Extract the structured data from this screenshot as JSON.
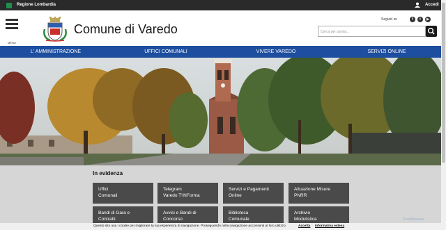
{
  "topbar": {
    "region_label": "Regione Lombardia",
    "login_label": "Accedi"
  },
  "header": {
    "menu_label": "MENU",
    "site_title": "Comune di Varedo",
    "social_label": "Seguici su",
    "search_placeholder": "Cerca per parola..."
  },
  "nav": {
    "items": [
      {
        "label": "L' AMMINISTRAZIONE"
      },
      {
        "label": "UFFICI COMUNALI"
      },
      {
        "label": "VIVERE VAREDO"
      },
      {
        "label": "SERVIZI ONLINE"
      }
    ]
  },
  "evidenza": {
    "title": "In evidenza",
    "tiles": [
      {
        "line1": "Uffici",
        "line2": "Comunali"
      },
      {
        "line1": "Telegram",
        "line2": "Varedo T'INForma"
      },
      {
        "line1": "Servizi e Pagamenti",
        "line2": "Online"
      },
      {
        "line1": "Attuazione Misure",
        "line2": "PNRR"
      },
      {
        "line1": "Bandi di Gara e",
        "line2": "Contratti"
      },
      {
        "line1": "Avvisi e Bandi di",
        "line2": "Concorso"
      },
      {
        "line1": "Biblioteca",
        "line2": "Comunale"
      },
      {
        "line1": "Archivio",
        "line2": "Modulistica"
      }
    ]
  },
  "cookie_bar": {
    "text": "Questo sito usa i cookie per migliorare la tua esperienza di navigazione. Proseguendo nella navigazione acconsenti al loro utilizzo.",
    "accept": "Accetta",
    "info": "Informativa estesa"
  },
  "watermark": "ScanMalware",
  "colors": {
    "nav_blue": "#1d4e9f",
    "topbar": "#2a2a2a",
    "tile": "#4a4a4a",
    "region_green": "#1e8f4e"
  },
  "icons": [
    "menu-icon",
    "user-icon",
    "facebook-icon",
    "twitter-icon",
    "youtube-icon",
    "search-icon"
  ]
}
